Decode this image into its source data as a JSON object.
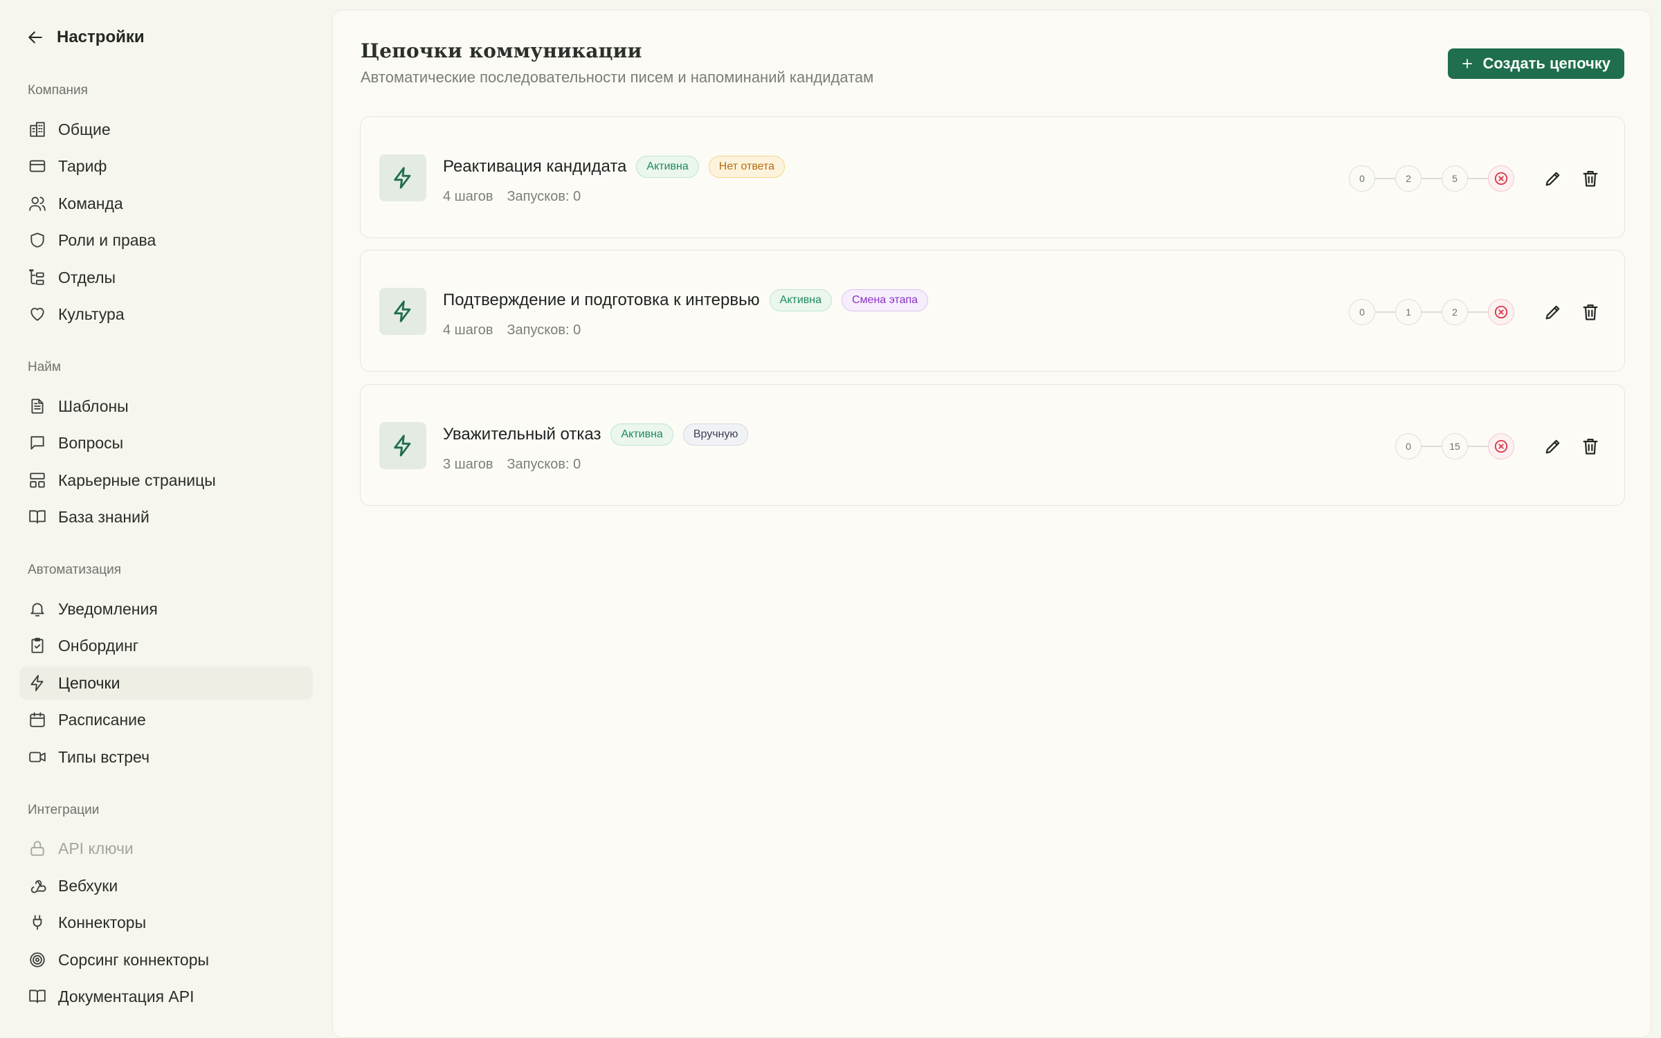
{
  "sidebar": {
    "back_label": "Настройки",
    "sections": {
      "company": "Компания",
      "hiring": "Найм",
      "automation": "Автоматизация",
      "integrations": "Интеграции"
    },
    "items": {
      "general": "Общие",
      "tariff": "Тариф",
      "team": "Команда",
      "roles": "Роли и права",
      "departments": "Отделы",
      "culture": "Культура",
      "templates": "Шаблоны",
      "questions": "Вопросы",
      "career_pages": "Карьерные страницы",
      "knowledge_base": "База знаний",
      "notifications": "Уведомления",
      "onboarding": "Онбординг",
      "chains": "Цепочки",
      "schedule": "Расписание",
      "meeting_types": "Типы встреч",
      "api_keys": "API ключи",
      "webhooks": "Вебхуки",
      "connectors": "Коннекторы",
      "sourcing_connectors": "Сорсинг коннекторы",
      "api_docs": "Документация API"
    },
    "active_item": "chains"
  },
  "main": {
    "title": "Цепочки коммуникации",
    "subtitle": "Автоматические последовательности писем и напоминаний кандидатам",
    "create_button": "Создать цепочку",
    "chains": [
      {
        "name": "Реактивация кандидата",
        "status_badge": "Активна",
        "trigger_badge": "Нет ответа",
        "steps_text": "4 шагов",
        "runs_text": "Запусков: 0",
        "step_days": [
          "0",
          "2",
          "5"
        ]
      },
      {
        "name": "Подтверждение и подготовка к интервью",
        "status_badge": "Активна",
        "trigger_badge": "Смена этапа",
        "steps_text": "4 шагов",
        "runs_text": "Запусков: 0",
        "step_days": [
          "0",
          "1",
          "2"
        ]
      },
      {
        "name": "Уважительный отказ",
        "status_badge": "Активна",
        "trigger_badge": "Вручную",
        "steps_text": "3 шагов",
        "runs_text": "Запусков: 0",
        "step_days": [
          "0",
          "15"
        ]
      }
    ]
  },
  "colors": {
    "accent": "#1f6e4d",
    "background": "#f6f5ee",
    "panel": "#fbfaf4",
    "active_badge": "#1f8a5a",
    "noreply_badge": "#b76b0d",
    "stage_badge": "#8a2fc7",
    "end_step": "#d8394a"
  }
}
